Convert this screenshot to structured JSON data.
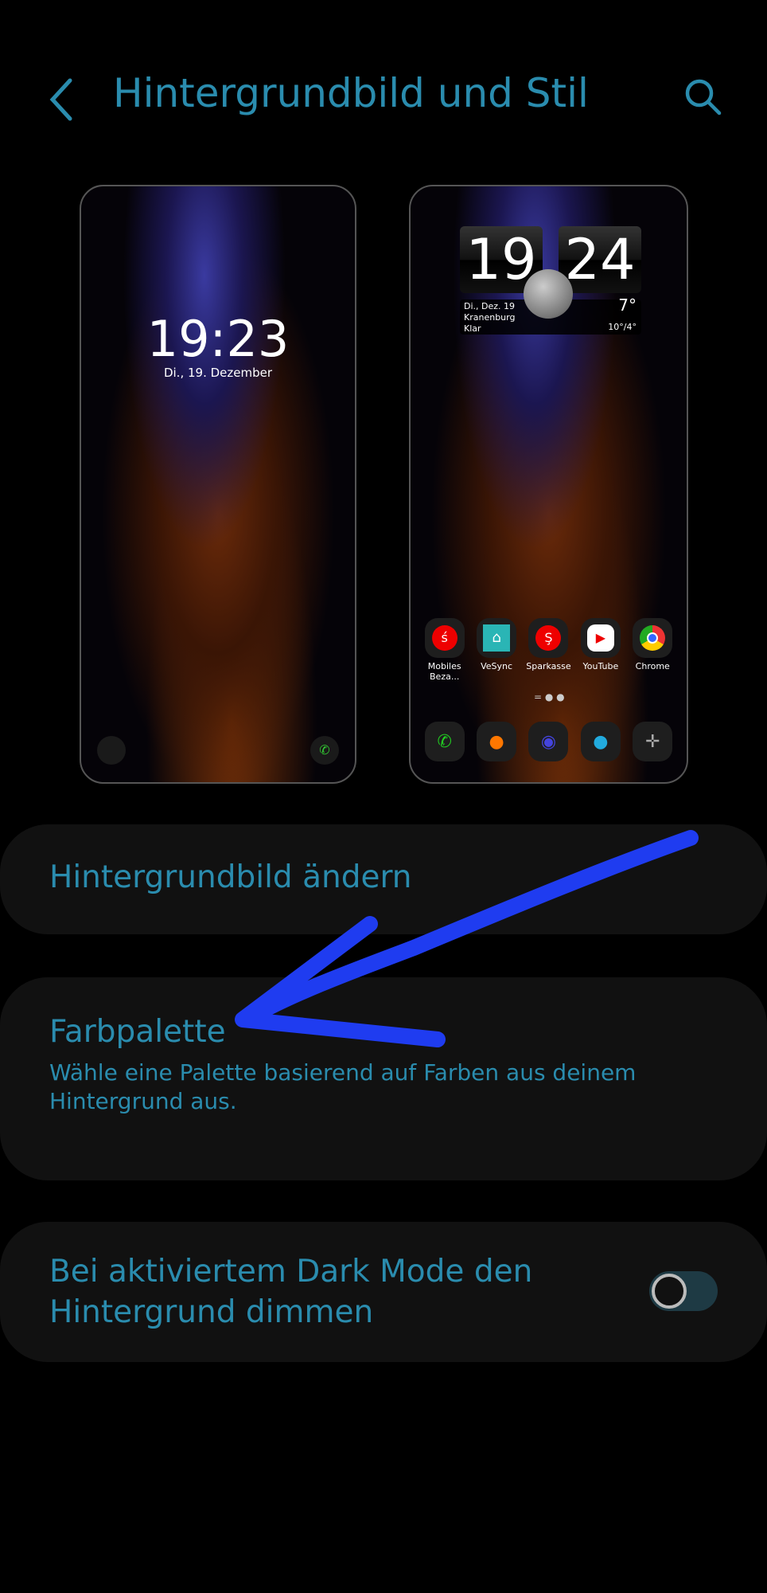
{
  "header": {
    "title": "Hintergrundbild und Stil",
    "back_icon": "chevron-left-icon",
    "search_icon": "search-icon"
  },
  "lock_preview": {
    "time": "19:23",
    "date": "Di., 19. Dezember"
  },
  "home_preview": {
    "clock_hour": "19",
    "clock_minute": "24",
    "weather": {
      "date": "Di., Dez. 19",
      "location": "Kranenburg",
      "condition": "Klar",
      "temp": "7°",
      "range": "10°/4°"
    },
    "apps": [
      {
        "label": "Mobiles Beza..."
      },
      {
        "label": "VeSync"
      },
      {
        "label": "Sparkasse"
      },
      {
        "label": "YouTube"
      },
      {
        "label": "Chrome"
      }
    ],
    "dock": [
      "phone-icon",
      "contacts-icon",
      "camera-icon",
      "messages-icon",
      "compass-icon"
    ]
  },
  "settings": {
    "change_wallpaper": "Hintergrundbild ändern",
    "palette_title": "Farbpalette",
    "palette_desc": "Wähle eine Palette basierend auf Farben aus deinem Hintergrund aus.",
    "dim_title": "Bei aktiviertem Dark Mode den Hintergrund dimmen",
    "dim_enabled": false
  },
  "colors": {
    "accent": "#2a8cae",
    "annotation": "#1f3cf0",
    "card": "#111111"
  }
}
